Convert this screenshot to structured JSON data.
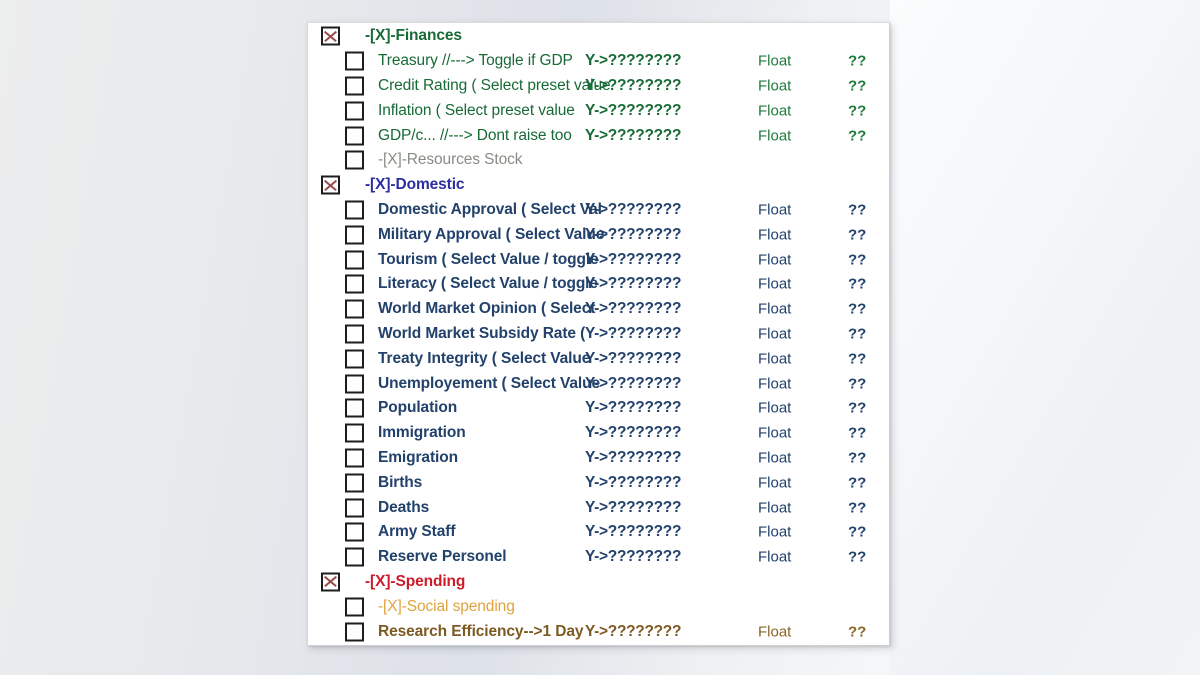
{
  "window": {
    "background_color": "#e9ebee",
    "panel_background": "#ffffff",
    "panel_border": "#cfcfcf"
  },
  "colors": {
    "finances_green": "#186a36",
    "resources_gray": "#878d84",
    "domestic_blue": "#2b2f9e",
    "domestic_item_navy": "#22416b",
    "spending_red": "#cc1b2a",
    "social_spending_orange": "#e0a23c",
    "research_brown": "#7d5a22",
    "checkbox_x": "#9b4a4a",
    "checkbox_border": "#1d1d1d"
  },
  "tree": {
    "rows": [
      {
        "id": "finances",
        "level": 0,
        "checkbox": "x",
        "label": "-[X]-Finances",
        "color_class": "c-green",
        "bold": true,
        "value": "",
        "type": "",
        "flags": ""
      },
      {
        "id": "treasury",
        "level": 1,
        "checkbox": "empty",
        "label": "Treasury //---> Toggle if GDP",
        "color_class": "c-green",
        "bold": false,
        "value": "Y->????????",
        "type": "Float",
        "flags": "??"
      },
      {
        "id": "credit-rating",
        "level": 1,
        "checkbox": "empty",
        "label": "Credit Rating ( Select preset value",
        "color_class": "c-green",
        "bold": false,
        "value": "Y->????????",
        "type": "Float",
        "flags": "??"
      },
      {
        "id": "inflation",
        "level": 1,
        "checkbox": "empty",
        "label": "Inflation  ( Select preset value",
        "color_class": "c-green",
        "bold": false,
        "value": "Y->????????",
        "type": "Float",
        "flags": "??"
      },
      {
        "id": "gdp-per-capita",
        "level": 1,
        "checkbox": "empty",
        "label": "GDP/c... //---> Dont raise too",
        "color_class": "c-green",
        "bold": false,
        "value": "Y->????????",
        "type": "Float",
        "flags": "??"
      },
      {
        "id": "resources-stock",
        "level": 1,
        "checkbox": "empty",
        "label": "-[X]-Resources Stock",
        "color_class": "c-gray",
        "bold": false,
        "value": "",
        "type": "",
        "flags": ""
      },
      {
        "id": "domestic",
        "level": 0,
        "checkbox": "x",
        "label": "-[X]-Domestic",
        "color_class": "c-blue",
        "bold": true,
        "value": "",
        "type": "",
        "flags": ""
      },
      {
        "id": "domestic-approval",
        "level": 1,
        "checkbox": "empty",
        "label": "Domestic Approval ( Select Val",
        "color_class": "c-navy",
        "bold": true,
        "value": "Y->????????",
        "type": "Float",
        "flags": "??"
      },
      {
        "id": "military-approval",
        "level": 1,
        "checkbox": "empty",
        "label": "Military Approval ( Select Value",
        "color_class": "c-navy",
        "bold": true,
        "value": "Y->????????",
        "type": "Float",
        "flags": "??"
      },
      {
        "id": "tourism",
        "level": 1,
        "checkbox": "empty",
        "label": "Tourism ( Select Value / toggle",
        "color_class": "c-navy",
        "bold": true,
        "value": "Y->????????",
        "type": "Float",
        "flags": "??"
      },
      {
        "id": "literacy",
        "level": 1,
        "checkbox": "empty",
        "label": "Literacy ( Select Value / toggle",
        "color_class": "c-navy",
        "bold": true,
        "value": "Y->????????",
        "type": "Float",
        "flags": "??"
      },
      {
        "id": "world-market-opinion",
        "level": 1,
        "checkbox": "empty",
        "label": "World Market Opinion ( Select",
        "color_class": "c-navy",
        "bold": true,
        "value": "Y->????????",
        "type": "Float",
        "flags": "??"
      },
      {
        "id": "world-market-subsidy-rate",
        "level": 1,
        "checkbox": "empty",
        "label": "World Market Subsidy Rate (",
        "color_class": "c-navy",
        "bold": true,
        "value": "Y->????????",
        "type": "Float",
        "flags": "??"
      },
      {
        "id": "treaty-integrity",
        "level": 1,
        "checkbox": "empty",
        "label": "Treaty Integrity ( Select Value",
        "color_class": "c-navy",
        "bold": true,
        "value": "Y->????????",
        "type": "Float",
        "flags": "??"
      },
      {
        "id": "unemployement",
        "level": 1,
        "checkbox": "empty",
        "label": "Unemployement ( Select Value",
        "color_class": "c-navy",
        "bold": true,
        "value": "Y->????????",
        "type": "Float",
        "flags": "??"
      },
      {
        "id": "population",
        "level": 1,
        "checkbox": "empty",
        "label": "Population",
        "color_class": "c-navy",
        "bold": true,
        "value": "Y->????????",
        "type": "Float",
        "flags": "??"
      },
      {
        "id": "immigration",
        "level": 1,
        "checkbox": "empty",
        "label": "Immigration",
        "color_class": "c-navy",
        "bold": true,
        "value": "Y->????????",
        "type": "Float",
        "flags": "??"
      },
      {
        "id": "emigration",
        "level": 1,
        "checkbox": "empty",
        "label": "Emigration",
        "color_class": "c-navy",
        "bold": true,
        "value": "Y->????????",
        "type": "Float",
        "flags": "??"
      },
      {
        "id": "births",
        "level": 1,
        "checkbox": "empty",
        "label": "Births",
        "color_class": "c-navy",
        "bold": true,
        "value": "Y->????????",
        "type": "Float",
        "flags": "??"
      },
      {
        "id": "deaths",
        "level": 1,
        "checkbox": "empty",
        "label": "Deaths",
        "color_class": "c-navy",
        "bold": true,
        "value": "Y->????????",
        "type": "Float",
        "flags": "??"
      },
      {
        "id": "army-staff",
        "level": 1,
        "checkbox": "empty",
        "label": "Army Staff",
        "color_class": "c-navy",
        "bold": true,
        "value": "Y->????????",
        "type": "Float",
        "flags": "??"
      },
      {
        "id": "reserve-personel",
        "level": 1,
        "checkbox": "empty",
        "label": "Reserve Personel",
        "color_class": "c-navy",
        "bold": true,
        "value": "Y->????????",
        "type": "Float",
        "flags": "??"
      },
      {
        "id": "spending",
        "level": 0,
        "checkbox": "x",
        "label": "-[X]-Spending",
        "color_class": "c-red",
        "bold": true,
        "value": "",
        "type": "",
        "flags": ""
      },
      {
        "id": "social-spending",
        "level": 1,
        "checkbox": "empty",
        "label": "-[X]-Social spending",
        "color_class": "c-orange",
        "bold": false,
        "value": "",
        "type": "",
        "flags": ""
      },
      {
        "id": "research-efficiency",
        "level": 1,
        "checkbox": "empty",
        "label": "Research Efficiency-->1 Day",
        "color_class": "c-brown",
        "bold": true,
        "value": "Y->????????",
        "type": "Float",
        "flags": "??"
      }
    ]
  }
}
